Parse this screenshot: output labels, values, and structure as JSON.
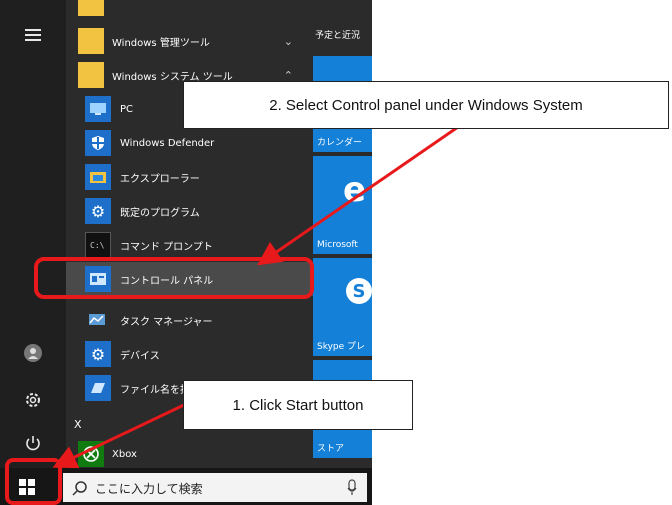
{
  "rail": {
    "icons": [
      "hamburger-menu-icon",
      "user-avatar-icon",
      "settings-gear-icon",
      "power-icon"
    ]
  },
  "apps": {
    "group1": "Windows 管理ツール",
    "group2": "Windows システム ツール",
    "items": [
      "PC",
      "Windows Defender",
      "エクスプローラー",
      "既定のプログラム",
      "コマンド プロンプト",
      "コントロール パネル",
      "タスク マネージャー",
      "デバイス",
      "ファイル名を指定して実行"
    ],
    "section_x": "X",
    "xbox": "Xbox"
  },
  "tiles": {
    "header": "予定と近況",
    "calendar": "カレンダー",
    "microsoft": "Microsoft",
    "skype": "Skype プレ",
    "store": "ストア"
  },
  "taskbar": {
    "search_placeholder": "ここに入力して検索"
  },
  "annotations": {
    "step1": "1. Click Start button",
    "step2": "2. Select Control panel under Windows System"
  },
  "colors": {
    "highlight": "#e8191b",
    "tile": "#1480d8"
  }
}
